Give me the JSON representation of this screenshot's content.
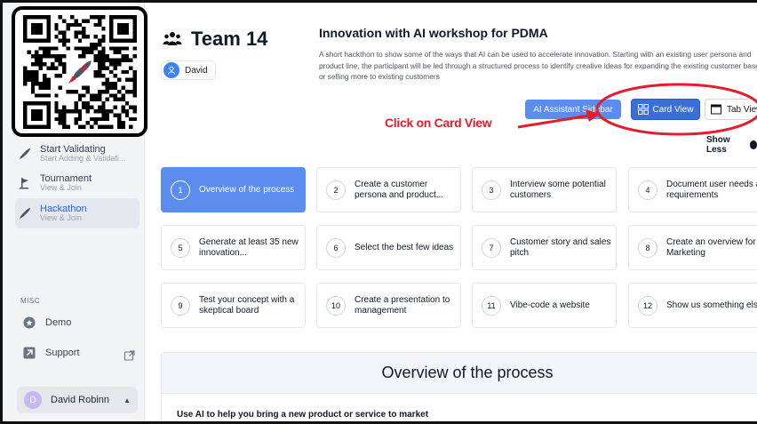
{
  "sidebar": {
    "items": [
      {
        "title": "Start Validating",
        "subtitle": "Start Adding & Validati..."
      },
      {
        "title": "Tournament",
        "subtitle": "View & Join"
      },
      {
        "title": "Hackathon",
        "subtitle": "View & Join"
      }
    ],
    "misc_label": "MISC",
    "misc_items": [
      {
        "label": "Demo"
      },
      {
        "label": "Support"
      }
    ],
    "user": {
      "initial": "D",
      "name": "David Robinn"
    }
  },
  "header": {
    "team_title": "Team 14",
    "user_name": "David",
    "workshop_title": "Innovation with AI workshop for PDMA",
    "workshop_desc": "A short hackthon to show some of the ways that AI can be used to accelerate innovation. Starting with an existing user persona and product line, the participant will be led through a structured process to identify creative ideas for expanding the existing customer base or selling more to existing customers"
  },
  "toolbar": {
    "ai_button": "AI Assistant Sidebar",
    "card_view": "Card View",
    "tab_view": "Tab View",
    "show_less": "Show Less"
  },
  "annotation": {
    "text": "Click on Card View",
    "color": "#e11d2e"
  },
  "steps": [
    {
      "num": "1",
      "label": "Overview of the process"
    },
    {
      "num": "2",
      "label": "Create a customer persona and product..."
    },
    {
      "num": "3",
      "label": "Interview some potential customers"
    },
    {
      "num": "4",
      "label": "Document user needs and requirements"
    },
    {
      "num": "5",
      "label": "Generate at least 35 new innovation..."
    },
    {
      "num": "6",
      "label": "Select the best few ideas"
    },
    {
      "num": "7",
      "label": "Customer story and sales pitch"
    },
    {
      "num": "8",
      "label": "Create an overview for Marketing"
    },
    {
      "num": "9",
      "label": "Test your concept with a skeptical board"
    },
    {
      "num": "10",
      "label": "Create a presentation to management"
    },
    {
      "num": "11",
      "label": "Vibe-code a website"
    },
    {
      "num": "12",
      "label": "Show us something else!"
    }
  ],
  "section": {
    "title": "Overview of the process",
    "subtitle": "Use AI to help you bring a new product or service to market"
  },
  "colors": {
    "accent": "#5b8def",
    "primary_button": "#3b6fd8",
    "highlight": "#e11d2e"
  }
}
